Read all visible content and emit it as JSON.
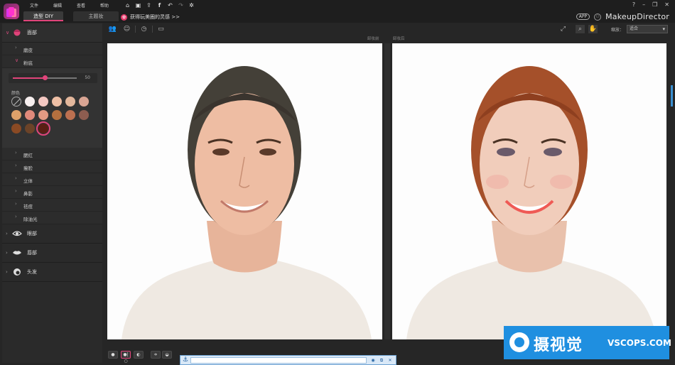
{
  "menus": [
    "文件",
    "编辑",
    "查看",
    "帮助"
  ],
  "tools": [
    "home-icon",
    "save-icon",
    "share-icon",
    "facebook-icon",
    "undo-icon",
    "redo-icon",
    "settings-icon"
  ],
  "window_controls": [
    "?",
    "–",
    "❐",
    "✕"
  ],
  "tabs": {
    "diy": "造型 DIY",
    "theme": "主题妆"
  },
  "promo": "获得玩美圈的灵感 >>",
  "brand": {
    "app_badge": "APP",
    "name": "MakeupDirector"
  },
  "sidebar": {
    "categories": {
      "face": "面部",
      "eyes": "眼部",
      "lips": "唇部",
      "hair": "头发"
    },
    "face_items": [
      "磨皮",
      "粉底",
      "腮红",
      "瘦脸",
      "立体",
      "鼻影",
      "祛痘",
      "除油光"
    ],
    "foundation": {
      "slider_value": "50",
      "slider_fraction": 0.5,
      "color_label": "颜色",
      "swatches": [
        "none",
        "#f7efef",
        "#f4c8c2",
        "#eebfa5",
        "#e3b79c",
        "#d9a594",
        "#dea16a",
        "#e0897a",
        "#e39a83",
        "#b5703f",
        "#bd7050",
        "#8e5d50",
        "#8a4a24",
        "#6c4328",
        "#5a1e14"
      ],
      "selected_index": 14
    }
  },
  "toolbar": {
    "zoom_label": "缩放：",
    "zoom_value": "适合"
  },
  "views": {
    "before": "卸妆前",
    "after": "卸妆后"
  },
  "watermark": {
    "cn": "摄视觉",
    "en": "VSCOPS.COM"
  }
}
